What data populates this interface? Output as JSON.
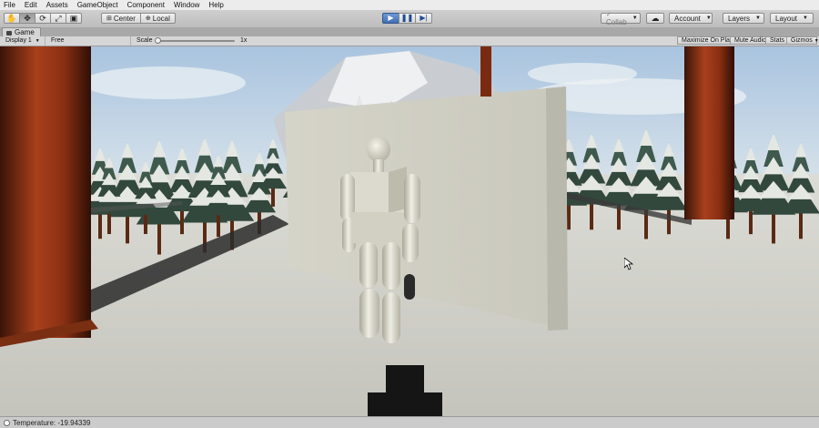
{
  "menu": [
    "File",
    "Edit",
    "Assets",
    "GameObject",
    "Component",
    "Window",
    "Help"
  ],
  "toolbar": {
    "transform_tools": [
      "hand-tool-icon",
      "move-tool-icon",
      "rotate-tool-icon",
      "scale-tool-icon",
      "rect-tool-icon"
    ],
    "pivot_label": "Center",
    "space_label": "Local",
    "collab_label": "Collab",
    "account_label": "Account",
    "layers_label": "Layers",
    "layout_label": "Layout"
  },
  "game_tab": {
    "label": "Game"
  },
  "game_bar": {
    "display_label": "Display 1",
    "aspect_label": "Free Aspect",
    "scale_label": "Scale",
    "scale_value": "1x",
    "maximize_label": "Maximize On Play",
    "mute_label": "Mute Audio",
    "stats_label": "Stats",
    "gizmos_label": "Gizmos"
  },
  "status": {
    "message": "Temperature: -19.94339"
  },
  "colors": {
    "play_blue": "#4a78bd",
    "snow": "#d3d4cc",
    "sky": "#bcd2e6"
  }
}
